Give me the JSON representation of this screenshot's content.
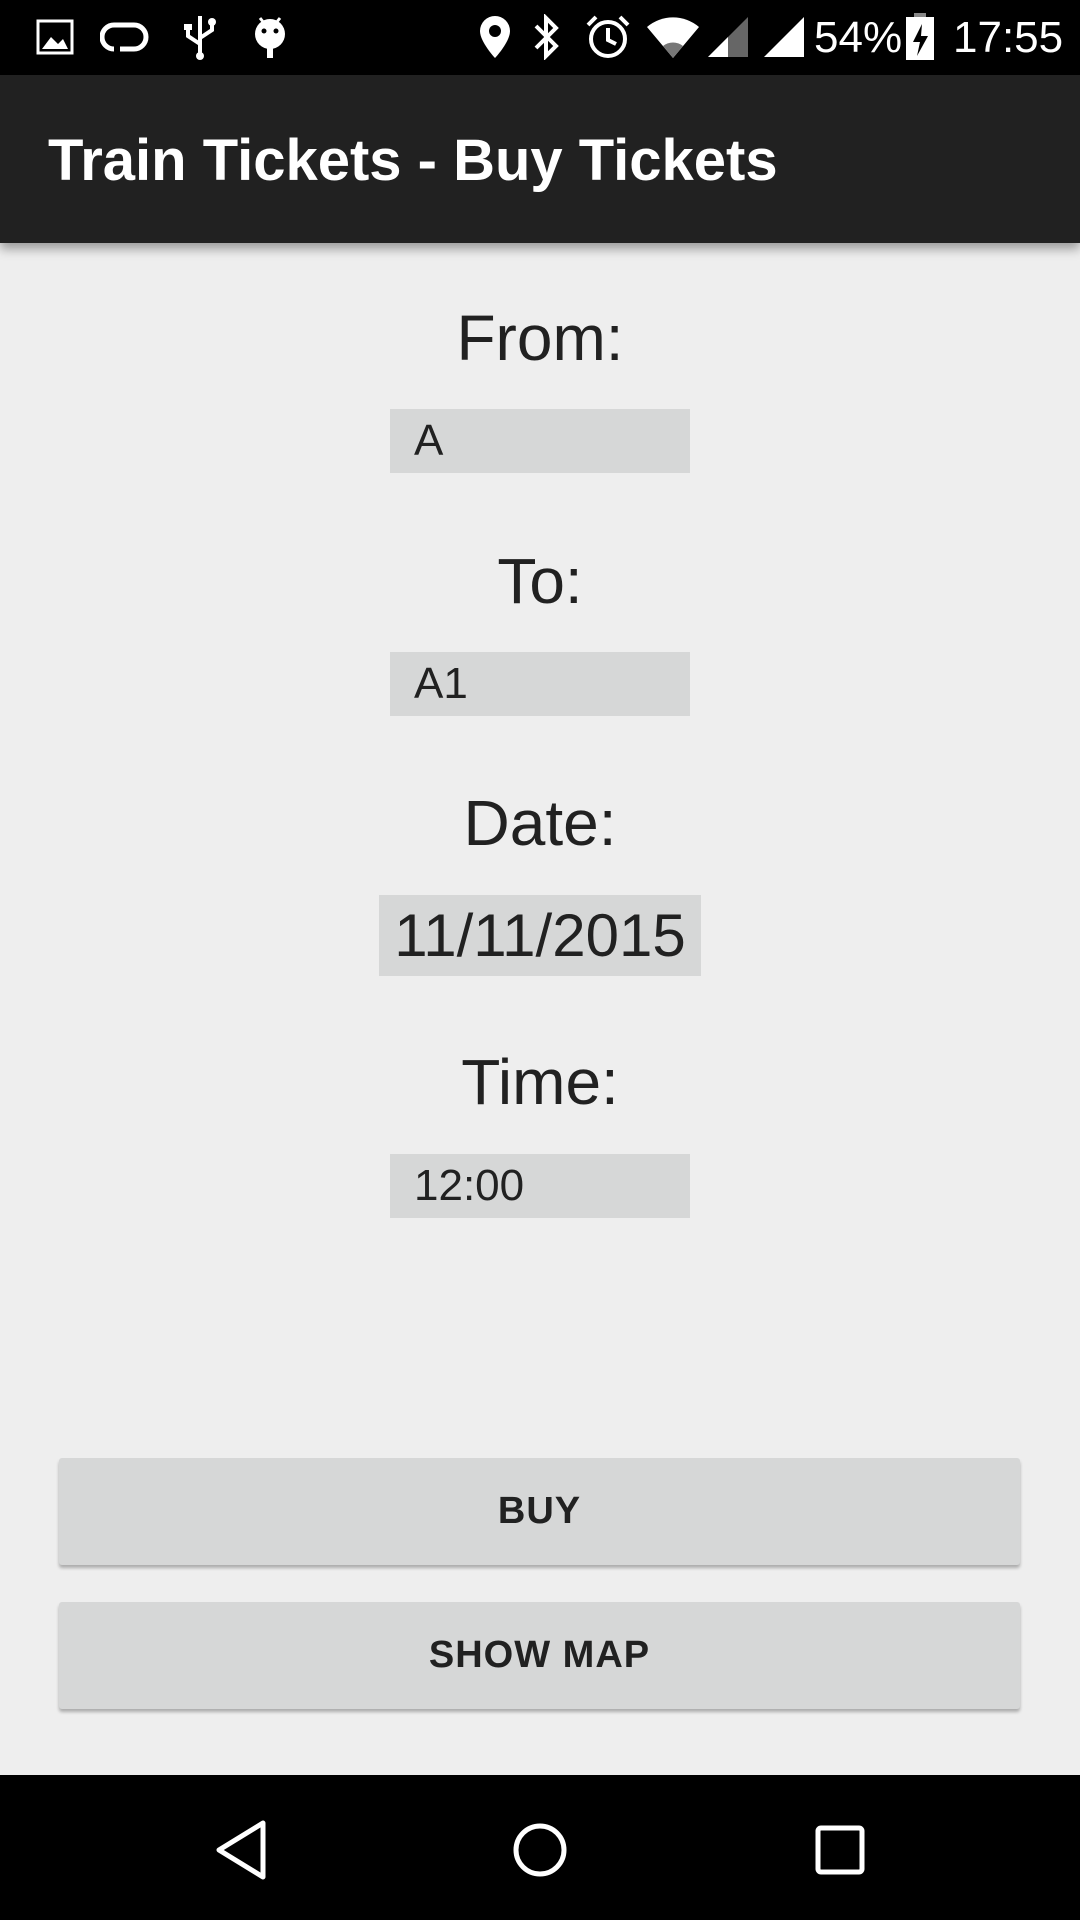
{
  "status_bar": {
    "battery_percent": "54%",
    "time": "17:55",
    "icons": [
      "image-icon",
      "sync-icon",
      "usb-icon",
      "android-debug-icon",
      "location-icon",
      "bluetooth-icon",
      "alarm-icon",
      "wifi-icon",
      "cell-signal-icon",
      "cell-signal-icon",
      "battery-charging-icon"
    ]
  },
  "app_bar": {
    "title": "Train Tickets - Buy Tickets"
  },
  "form": {
    "from_label": "From:",
    "from_value": "A",
    "to_label": "To:",
    "to_value": "A1",
    "date_label": "Date:",
    "date_value": "11/11/2015",
    "time_label": "Time:",
    "time_value": "12:00"
  },
  "buttons": {
    "buy_label": "BUY",
    "show_map_label": "SHOW MAP"
  },
  "nav_bar": {
    "icons": [
      "back-icon",
      "home-icon",
      "recents-icon"
    ]
  },
  "colors": {
    "app_bar": "#212121",
    "background": "#eeeeee",
    "field_background": "#d6d7d7"
  }
}
